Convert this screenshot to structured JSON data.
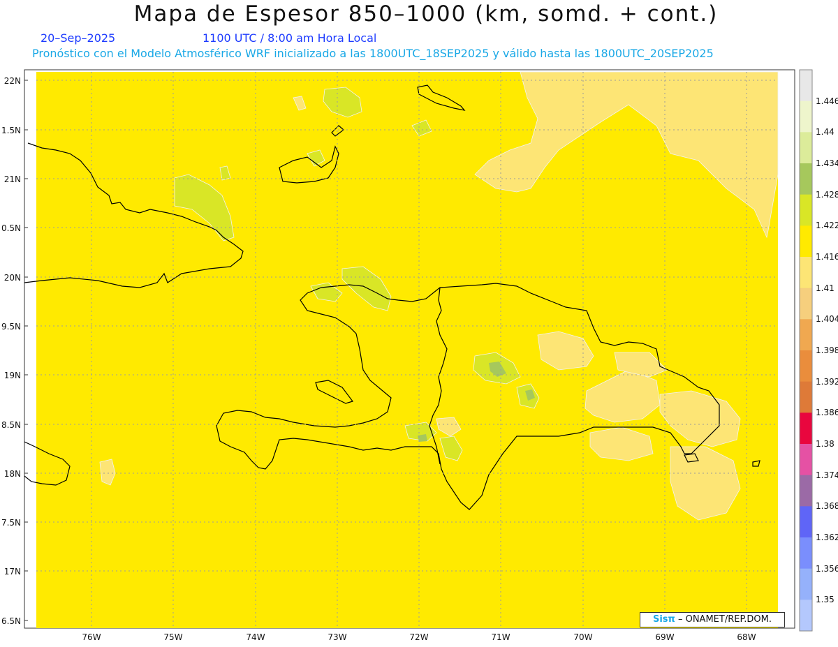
{
  "title": "Mapa de Espesor 850–1000 (km, somd. + cont.)",
  "date": "20–Sep–2025",
  "time": "1100 UTC / 8:00 am Hora Local",
  "forecast_line": "Pronóstico con el Modelo Atmosférico WRF inicializado a las 1800UTC_18SEP2025 y válido hasta las  1800UTC_20SEP2025",
  "credit": {
    "brand": "Sisπ",
    "suffix": "– ONAMET/REP.DOM."
  },
  "axes": {
    "lat_labels": [
      "22N",
      "1.5N",
      "21N",
      "0.5N",
      "20N",
      "9.5N",
      "19N",
      "8.5N",
      "18N",
      "7.5N",
      "17N",
      "6.5N"
    ],
    "lon_labels": [
      "76W",
      "75W",
      "74W",
      "73W",
      "72W",
      "71W",
      "70W",
      "69W",
      "68W"
    ]
  },
  "colorbar": {
    "labels": [
      "1.446",
      "1.44",
      "1.434",
      "1.428",
      "1.422",
      "1.416",
      "1.41",
      "1.404",
      "1.398",
      "1.392",
      "1.386",
      "1.38",
      "1.374",
      "1.368",
      "1.362",
      "1.356",
      "1.35"
    ],
    "colors": [
      "#e8e8e8",
      "#eef5cc",
      "#dcec9a",
      "#a6c85c",
      "#d9e626",
      "#ffea00",
      "#fde575",
      "#f6cf7d",
      "#f0a850",
      "#ea8d3c",
      "#de7a38",
      "#e9063e",
      "#e551a4",
      "#9b6aa6",
      "#5f65f7",
      "#7a8efd",
      "#95b1fb",
      "#b4c8fd"
    ],
    "base_color": "#ffea00",
    "lighter_color": "#fde575",
    "green_color": "#d9e626",
    "darkgreen_color": "#a6c85c"
  }
}
